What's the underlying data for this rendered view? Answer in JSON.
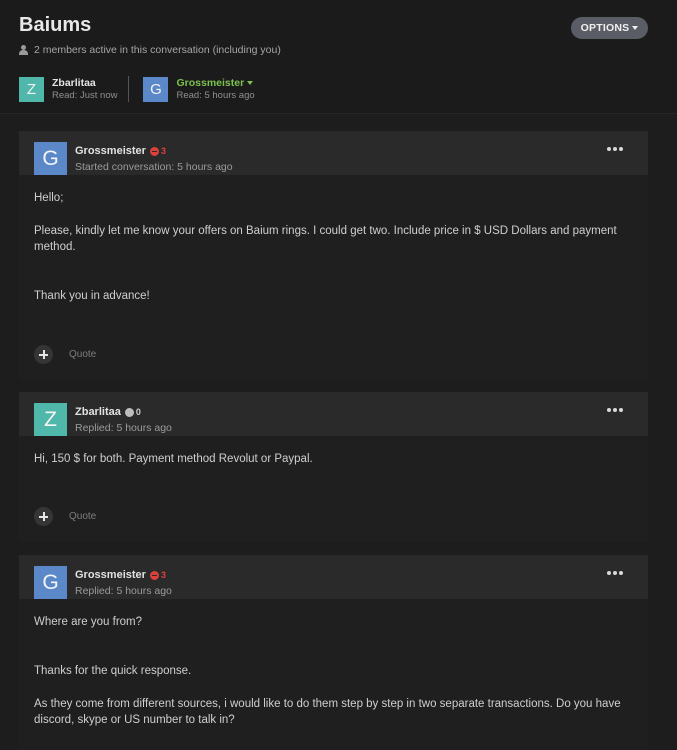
{
  "conversation": {
    "title": "Baiums",
    "options_label": "OPTIONS",
    "members_text": "2 members active in this conversation (including you)"
  },
  "participants": [
    {
      "initial": "Z",
      "name": "Zbarlitaa",
      "read": "Read: Just now",
      "avatar_color": "#4fb8aa"
    },
    {
      "initial": "G",
      "name": "Grossmeister",
      "read": "Read: 5 hours ago",
      "avatar_color": "#5a88c8",
      "name_color": "#7cc24e"
    }
  ],
  "messages": [
    {
      "initial": "G",
      "author": "Grossmeister",
      "reputation": "3",
      "reputation_type": "negative",
      "meta": "Started conversation: 5 hours ago",
      "paragraphs": [
        "Hello;",
        "Please, kindly let me know your offers on Baium rings. I could get two. Include price in $ USD Dollars and payment method.",
        "Thank you in advance!"
      ],
      "quote_label": "Quote"
    },
    {
      "initial": "Z",
      "author": "Zbarlitaa",
      "reputation": "0",
      "reputation_type": "neutral",
      "meta": "Replied: 5 hours ago",
      "paragraphs": [
        "Hi, 150 $ for both. Payment method Revolut or Paypal."
      ],
      "quote_label": "Quote"
    },
    {
      "initial": "G",
      "author": "Grossmeister",
      "reputation": "3",
      "reputation_type": "negative",
      "meta": "Replied: 5 hours ago",
      "paragraphs": [
        "Where are you from?",
        "Thanks for the quick response.",
        "As they come from different sources, i would like to do them step by step in two separate transactions. Do you have discord, skype or US number to talk in?"
      ]
    }
  ],
  "colors": {
    "background": "#1b1b1b",
    "header_bar": "#2a2a2a",
    "options_button": "#5a5d66",
    "negative_rep": "#d9413a",
    "online_name": "#7cc24e"
  }
}
